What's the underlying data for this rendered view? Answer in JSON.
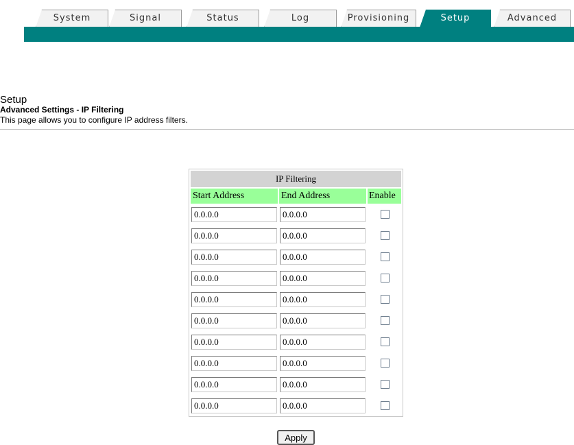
{
  "nav": {
    "tabs": [
      {
        "label": "System"
      },
      {
        "label": "Signal"
      },
      {
        "label": "Status"
      },
      {
        "label": "Log"
      },
      {
        "label": "Provisioning"
      },
      {
        "label": "Setup"
      },
      {
        "label": "Advanced"
      }
    ],
    "active_tab": "Setup",
    "accent_color": "#008080"
  },
  "header": {
    "title": "Setup",
    "subtitle": "Advanced Settings - IP Filtering",
    "description": "This page allows you to configure IP address filters."
  },
  "ip_filter": {
    "caption": "IP Filtering",
    "columns": {
      "start": "Start Address",
      "end": "End Address",
      "enable": "Enable"
    },
    "header_color": "#99ff99",
    "rows": [
      {
        "start": "0.0.0.0",
        "end": "0.0.0.0",
        "enabled": false
      },
      {
        "start": "0.0.0.0",
        "end": "0.0.0.0",
        "enabled": false
      },
      {
        "start": "0.0.0.0",
        "end": "0.0.0.0",
        "enabled": false
      },
      {
        "start": "0.0.0.0",
        "end": "0.0.0.0",
        "enabled": false
      },
      {
        "start": "0.0.0.0",
        "end": "0.0.0.0",
        "enabled": false
      },
      {
        "start": "0.0.0.0",
        "end": "0.0.0.0",
        "enabled": false
      },
      {
        "start": "0.0.0.0",
        "end": "0.0.0.0",
        "enabled": false
      },
      {
        "start": "0.0.0.0",
        "end": "0.0.0.0",
        "enabled": false
      },
      {
        "start": "0.0.0.0",
        "end": "0.0.0.0",
        "enabled": false
      },
      {
        "start": "0.0.0.0",
        "end": "0.0.0.0",
        "enabled": false
      }
    ]
  },
  "actions": {
    "apply_label": "Apply"
  }
}
